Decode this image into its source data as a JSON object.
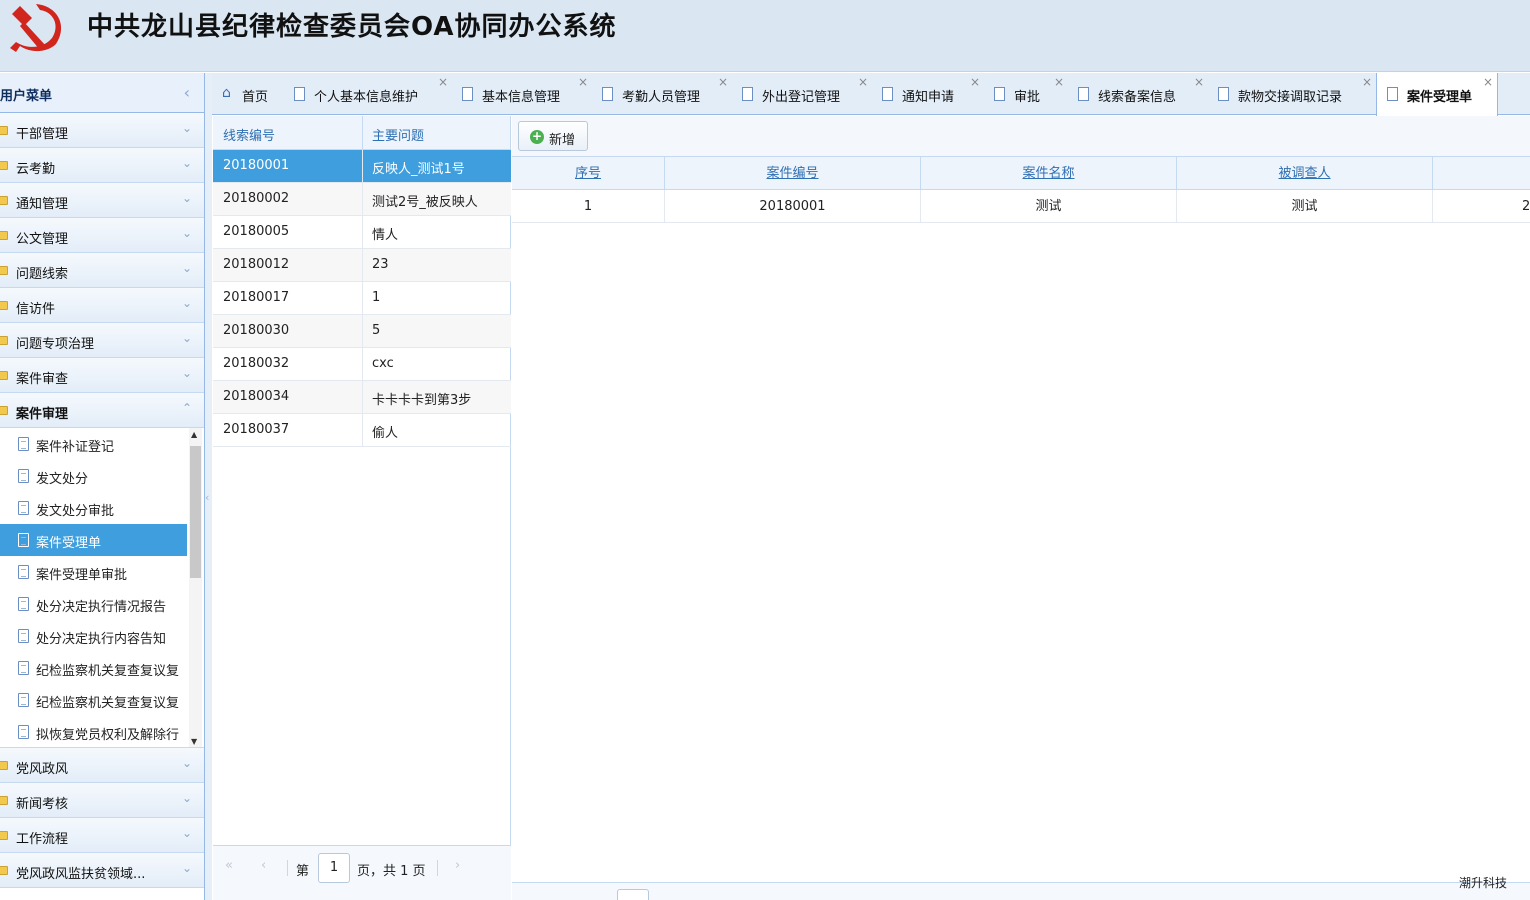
{
  "app": {
    "title": "中共龙山县纪律检查委员会OA协同办公系统"
  },
  "sidebar": {
    "title": "用户菜单",
    "groups_top": [
      {
        "label": "干部管理"
      },
      {
        "label": "云考勤"
      },
      {
        "label": "通知管理"
      },
      {
        "label": "公文管理"
      },
      {
        "label": "问题线索"
      },
      {
        "label": "信访件"
      },
      {
        "label": "问题专项治理"
      },
      {
        "label": "案件审查"
      }
    ],
    "open_group": {
      "label": "案件审理"
    },
    "sub_items": [
      {
        "label": "案件补证登记"
      },
      {
        "label": "发文处分"
      },
      {
        "label": "发文处分审批"
      },
      {
        "label": "案件受理单"
      },
      {
        "label": "案件受理单审批"
      },
      {
        "label": "处分决定执行情况报告"
      },
      {
        "label": "处分决定执行内容告知"
      },
      {
        "label": "纪检监察机关复查复议复"
      },
      {
        "label": "纪检监察机关复查复议复"
      },
      {
        "label": "拟恢复党员权利及解除行"
      }
    ],
    "groups_bottom": [
      {
        "label": "党风政风"
      },
      {
        "label": "新闻考核"
      },
      {
        "label": "工作流程"
      },
      {
        "label": "党风政风监扶贫领域..."
      }
    ]
  },
  "tabs": [
    {
      "label": "首页"
    },
    {
      "label": "个人基本信息维护"
    },
    {
      "label": "基本信息管理"
    },
    {
      "label": "考勤人员管理"
    },
    {
      "label": "外出登记管理"
    },
    {
      "label": "通知申请"
    },
    {
      "label": "审批"
    },
    {
      "label": "线索备案信息"
    },
    {
      "label": "款物交接调取记录"
    },
    {
      "label": "案件受理单"
    }
  ],
  "left_grid": {
    "headers": [
      "线索编号",
      "主要问题"
    ],
    "rows": [
      {
        "id": "20180001",
        "issue": "反映人_测试1号"
      },
      {
        "id": "20180002",
        "issue": "测试2号_被反映人"
      },
      {
        "id": "20180005",
        "issue": "情人"
      },
      {
        "id": "20180012",
        "issue": "23"
      },
      {
        "id": "20180017",
        "issue": "1"
      },
      {
        "id": "20180030",
        "issue": "5"
      },
      {
        "id": "20180032",
        "issue": "cxc"
      },
      {
        "id": "20180034",
        "issue": "卡卡卡卡到第3步"
      },
      {
        "id": "20180037",
        "issue": "偷人"
      }
    ],
    "pager": {
      "prefix": "第",
      "page": "1",
      "suffix": "页，共 1 页"
    }
  },
  "toolbar": {
    "add_label": "新增"
  },
  "right_grid": {
    "headers": [
      "序号",
      "案件编号",
      "案件名称",
      "被调查人"
    ],
    "rows": [
      {
        "no": "1",
        "case_no": "20180001",
        "case_name": "测试",
        "person": "测试",
        "extra": "2"
      }
    ]
  },
  "footer": {
    "brand": "潮升科技"
  },
  "colors": {
    "accent": "#3e9ede",
    "header_bg": "#dae7f3",
    "border": "#95b8e7"
  }
}
